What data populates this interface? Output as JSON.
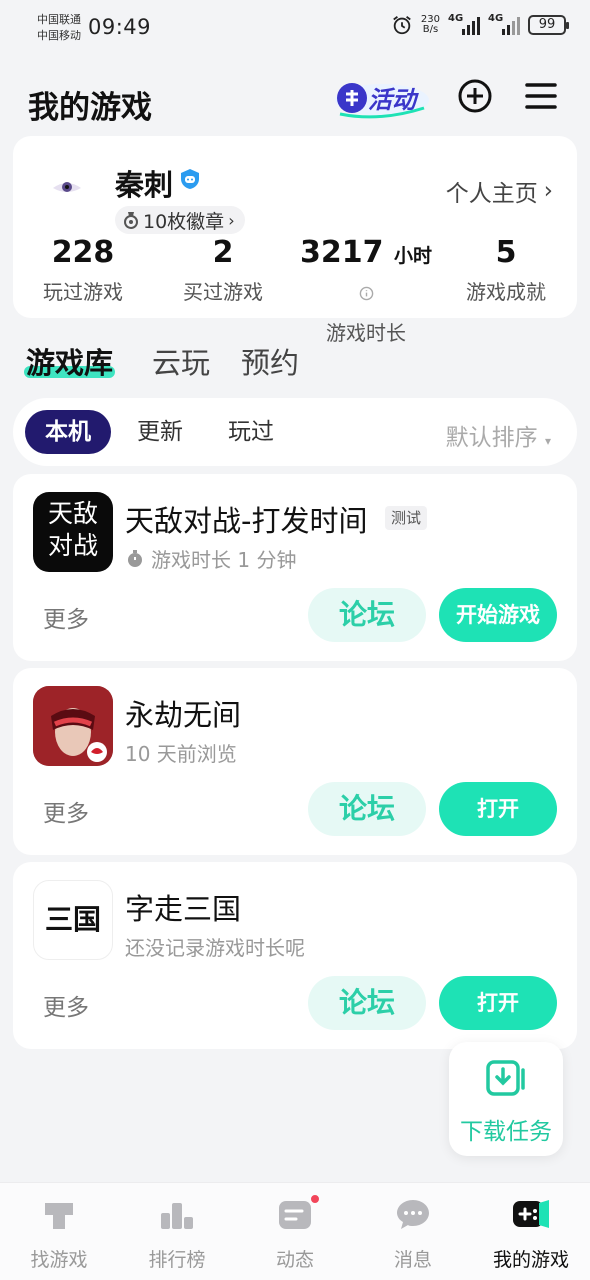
{
  "status_bar": {
    "carrier_1": "中国联通",
    "carrier_2": "中国移动",
    "time": "09:49",
    "net_speed_value": "230",
    "net_speed_unit": "B/s",
    "signal_1": "4G",
    "signal_2": "4G",
    "battery": "99"
  },
  "header": {
    "title": "我的游戏",
    "activity_label": "活动"
  },
  "profile": {
    "name": "秦刺",
    "badges": "10枚徽章",
    "homepage_link": "个人主页",
    "stats": [
      {
        "value": "228",
        "unit": "",
        "label": "玩过游戏"
      },
      {
        "value": "2",
        "unit": "",
        "label": "买过游戏"
      },
      {
        "value": "3217",
        "unit": "小时",
        "label": "游戏时长"
      },
      {
        "value": "5",
        "unit": "",
        "label": "游戏成就"
      }
    ]
  },
  "library_tabs": [
    "游戏库",
    "云玩",
    "预约"
  ],
  "filters": {
    "chips": [
      "本机",
      "更新",
      "玩过"
    ],
    "sort": "默认排序"
  },
  "games": [
    {
      "name": "天敌对战-打发时间",
      "tag": "测试",
      "meta": "游戏时长 1 分钟",
      "icon_text_line1": "天敌",
      "icon_text_line2": "对战",
      "more": "更多",
      "forum": "论坛",
      "action": "开始游戏"
    },
    {
      "name": "永劫无间",
      "tag": "",
      "meta": "10 天前浏览",
      "more": "更多",
      "forum": "论坛",
      "action": "打开"
    },
    {
      "name": "字走三国",
      "tag": "",
      "meta": "还没记录游戏时长呢",
      "icon_text": "三国",
      "more": "更多",
      "forum": "论坛",
      "action": "打开"
    }
  ],
  "download_tasks": "下载任务",
  "bottom_nav": [
    {
      "label": "找游戏",
      "icon": "find-game-icon"
    },
    {
      "label": "排行榜",
      "icon": "ranking-icon"
    },
    {
      "label": "动态",
      "icon": "feed-icon"
    },
    {
      "label": "消息",
      "icon": "message-icon"
    },
    {
      "label": "我的游戏",
      "icon": "my-games-icon"
    }
  ],
  "colors": {
    "accent": "#1ee2b5",
    "accent_light": "#e6f9f5",
    "chip_active": "#221a6e",
    "notification_dot": "#f2455a"
  }
}
